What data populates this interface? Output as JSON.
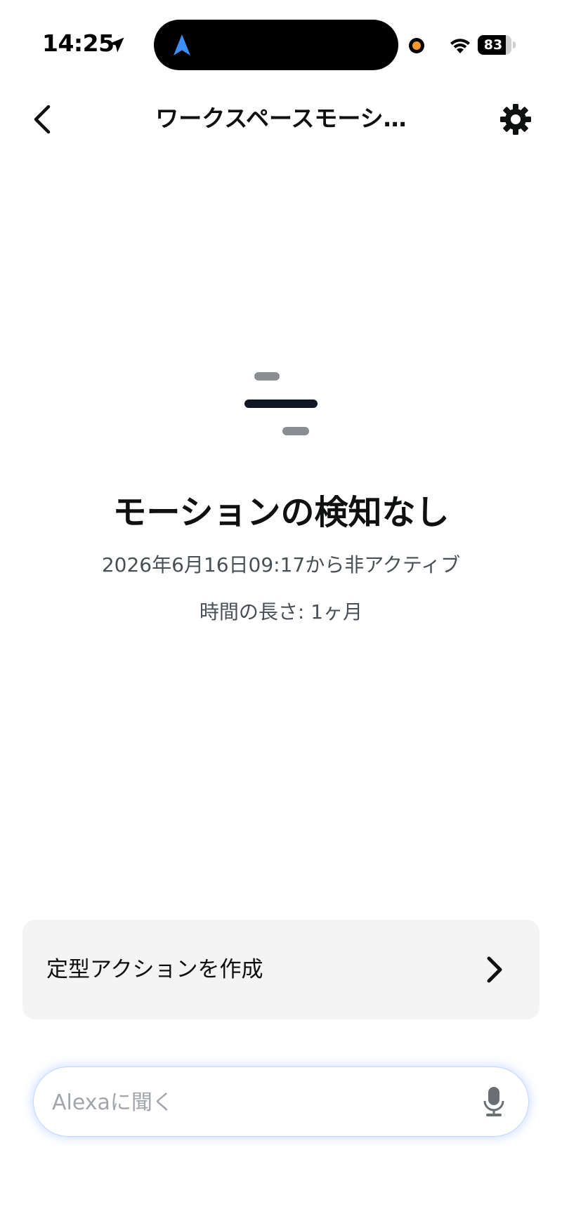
{
  "status_bar": {
    "time": "14:25",
    "battery_level": "83",
    "battery_fraction": 0.83,
    "icons": [
      "location-arrow-icon",
      "navigation-arrow-icon",
      "recording-dot-icon",
      "wifi-icon",
      "battery-icon"
    ]
  },
  "header": {
    "title": "ワークスペースモーシ…",
    "back_icon": "chevron-left-icon",
    "settings_icon": "gear-icon"
  },
  "motion": {
    "icon": "motion-lines-icon",
    "title": "モーションの検知なし",
    "inactive_since": "2026年6月16日09:17から非アクティブ",
    "duration": "時間の長さ: 1ヶ月"
  },
  "routine": {
    "label": "定型アクションを作成",
    "icon": "chevron-right-icon"
  },
  "alexa": {
    "placeholder": "Alexaに聞く",
    "mic_icon": "microphone-icon"
  },
  "colors": {
    "text_primary": "#0f1111",
    "text_secondary": "#4a4f55",
    "card_background": "#f4f4f4",
    "placeholder": "#a2a6ab",
    "nav_arrow_blue": "#3d8ff5",
    "recording_orange": "#f39a2d"
  }
}
